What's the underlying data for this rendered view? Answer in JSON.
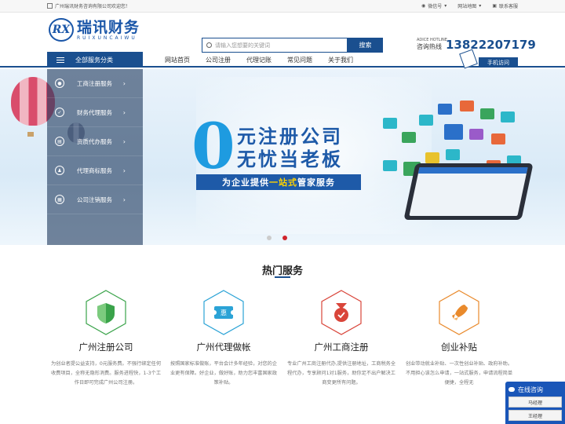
{
  "topbar": {
    "welcome": "广州瑞讯财务咨询有限公司欢迎您！",
    "wechat": "微信号",
    "sitemap": "网站地图",
    "contact": "联系客服"
  },
  "logo": {
    "cn": "瑞讯财务",
    "en": "RUIXUNCAIWU",
    "mark": "RX"
  },
  "search": {
    "placeholder": "请输入您想要的关键词",
    "button": "搜索"
  },
  "hotline": {
    "en": "ADICE HOTLINE",
    "cn": "咨询热线",
    "number": "13822207179"
  },
  "nav": {
    "all_categories": "全部服务分类",
    "items": [
      "网站首页",
      "公司注册",
      "代理记账",
      "常见问题",
      "关于我们"
    ],
    "mobile": "手机访问"
  },
  "sidemenu": [
    {
      "label": "工商注册服务",
      "icon": "user-icon"
    },
    {
      "label": "财务代理服务",
      "icon": "check-icon"
    },
    {
      "label": "资质代办服务",
      "icon": "document-icon"
    },
    {
      "label": "代理商标服务",
      "icon": "person-icon"
    },
    {
      "label": "公司注销服务",
      "icon": "grid-icon"
    }
  ],
  "banner": {
    "zero": "0",
    "line1": "元注册公司",
    "line2": "无忧当老板",
    "ribbon_prefix": "为企业提供",
    "ribbon_highlight": "一站式",
    "ribbon_suffix": "管家服务",
    "slide_count": 2,
    "active_slide": 2
  },
  "hot": {
    "title": "热门服务",
    "services": [
      {
        "name": "广州注册公司",
        "desc": "为创业者提公益支持，0元服务费。不强行绑定任何收费项目，全称无隐形消费。服务进程快，1-3个工作日即可完成广州公司注册。",
        "color": "#3aa34a",
        "icon": "shield-icon"
      },
      {
        "name": "广州代理做帐",
        "desc": "按照国家标准做账，平台会计多年经验，对您的企业更有保障。好企业，做好账，助力您丰富国家政策补贴。",
        "color": "#2ba3d6",
        "icon": "ticket-icon"
      },
      {
        "name": "广州工商注册",
        "desc": "专业广州工商注册代办,提供注册地址，工商税务全程代办，专享顾问1对1服务，助你足不出户解决工商变更所有问题。",
        "color": "#d9453a",
        "icon": "medal-icon"
      },
      {
        "name": "创业补贴",
        "desc": "创业带动就业补贴、一次性创业补贴、政府补助。不用担心该怎么申请，一站式服务，申请流程简单便捷，全程无",
        "color": "#e98a2c",
        "icon": "rocket-icon"
      }
    ]
  },
  "consult": {
    "title": "在线咨询",
    "managers": [
      "马经理",
      "王经理"
    ]
  }
}
